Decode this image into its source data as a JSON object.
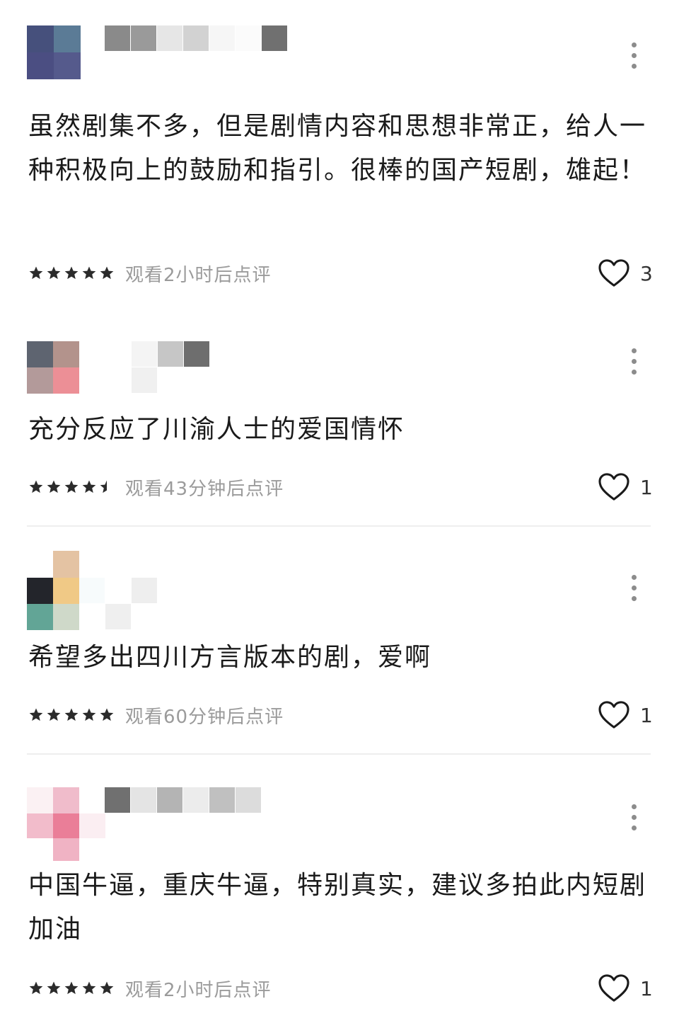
{
  "comments": [
    {
      "text": "虽然剧集不多，但是剧情内容和思想非常正，给人一种积极向上的鼓励和指引。很棒的国产短剧，雄起！",
      "rating": 5,
      "watch_note": "观看2小时后点评",
      "like_count": "3",
      "icons": {
        "more": "more-vertical-icon",
        "like": "heart-outline-icon"
      }
    },
    {
      "text": "充分反应了川渝人士的爱国情怀",
      "rating": 4.5,
      "watch_note": "观看43分钟后点评",
      "like_count": "1",
      "icons": {
        "more": "more-vertical-icon",
        "like": "heart-outline-icon"
      }
    },
    {
      "text": "希望多出四川方言版本的剧，爱啊",
      "rating": 5,
      "watch_note": "观看60分钟后点评",
      "like_count": "1",
      "icons": {
        "more": "more-vertical-icon",
        "like": "heart-outline-icon"
      }
    },
    {
      "text": "中国牛逼，重庆牛逼，特别真实，建议多拍此内短剧加油",
      "rating": 5,
      "watch_note": "观看2小时后点评",
      "like_count": "1",
      "icons": {
        "more": "more-vertical-icon",
        "like": "heart-outline-icon"
      }
    }
  ],
  "colors": {
    "star": "#2b2b2b",
    "meta_text": "#9b9b9b",
    "divider": "#eeeeee"
  }
}
